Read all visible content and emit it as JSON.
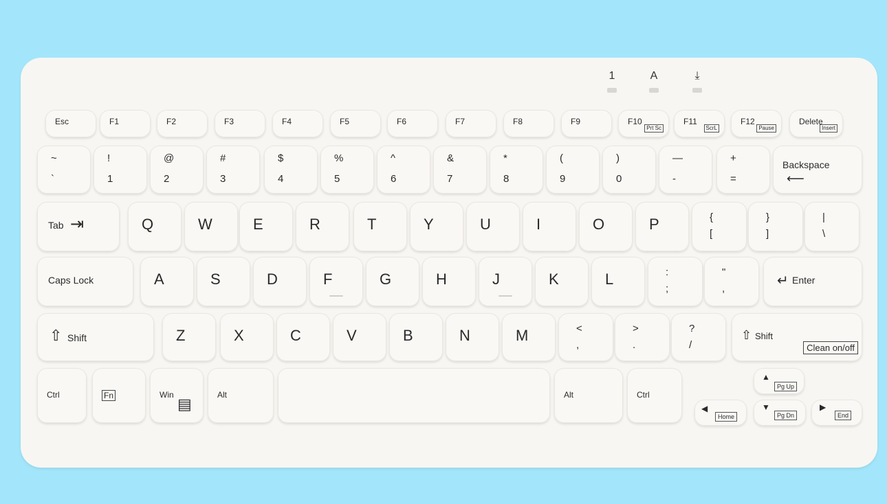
{
  "indicators": [
    "1",
    "A",
    "⤓"
  ],
  "fn_row": [
    {
      "label": "Esc",
      "sub": ""
    },
    {
      "label": "F1",
      "sub": ""
    },
    {
      "label": "F2",
      "sub": ""
    },
    {
      "label": "F3",
      "sub": ""
    },
    {
      "label": "F4",
      "sub": ""
    },
    {
      "label": "F5",
      "sub": ""
    },
    {
      "label": "F6",
      "sub": ""
    },
    {
      "label": "F7",
      "sub": ""
    },
    {
      "label": "F8",
      "sub": ""
    },
    {
      "label": "F9",
      "sub": ""
    },
    {
      "label": "F10",
      "sub": "Prt Sc"
    },
    {
      "label": "F11",
      "sub": "ScrL"
    },
    {
      "label": "F12",
      "sub": "Pause"
    },
    {
      "label": "Delete",
      "sub": "Insert"
    }
  ],
  "number_row": [
    {
      "top": "~",
      "bottom": "`"
    },
    {
      "top": "!",
      "bottom": "1"
    },
    {
      "top": "@",
      "bottom": "2"
    },
    {
      "top": "#",
      "bottom": "3"
    },
    {
      "top": "$",
      "bottom": "4"
    },
    {
      "top": "%",
      "bottom": "5"
    },
    {
      "top": "^",
      "bottom": "6"
    },
    {
      "top": "&",
      "bottom": "7"
    },
    {
      "top": "*",
      "bottom": "8"
    },
    {
      "top": "(",
      "bottom": "9"
    },
    {
      "top": ")",
      "bottom": "0"
    },
    {
      "top": "—",
      "bottom": "-"
    },
    {
      "top": "+",
      "bottom": "="
    }
  ],
  "backspace": "Backspace",
  "tab": "Tab",
  "qwerty_row": [
    "Q",
    "W",
    "E",
    "R",
    "T",
    "Y",
    "U",
    "I",
    "O",
    "P"
  ],
  "brackets": [
    {
      "top": "{",
      "bottom": "["
    },
    {
      "top": "}",
      "bottom": "]"
    },
    {
      "top": "|",
      "bottom": "\\"
    }
  ],
  "caps_lock": "Caps Lock",
  "home_row": [
    "A",
    "S",
    "D",
    "F",
    "G",
    "H",
    "J",
    "K",
    "L"
  ],
  "home_punct": [
    {
      "top": ":",
      "bottom": ";"
    },
    {
      "top": "\"",
      "bottom": ","
    }
  ],
  "enter": "Enter",
  "shift": "Shift",
  "bottom_row_letters": [
    "Z",
    "X",
    "C",
    "V",
    "B",
    "N",
    "M"
  ],
  "bottom_punct": [
    {
      "top": "<",
      "bottom": ","
    },
    {
      "top": ">",
      "bottom": "."
    },
    {
      "top": "?",
      "bottom": "/"
    }
  ],
  "shift_right": "Shift",
  "clean": "Clean on/off",
  "ctrl": "Ctrl",
  "fn": "Fn",
  "win": "Win",
  "alt": "Alt",
  "alt_right": "Alt",
  "ctrl_right": "Ctrl",
  "nav": {
    "pgup": "Pg Up",
    "pgdn": "Pg Dn",
    "home": "Home",
    "end": "End"
  }
}
